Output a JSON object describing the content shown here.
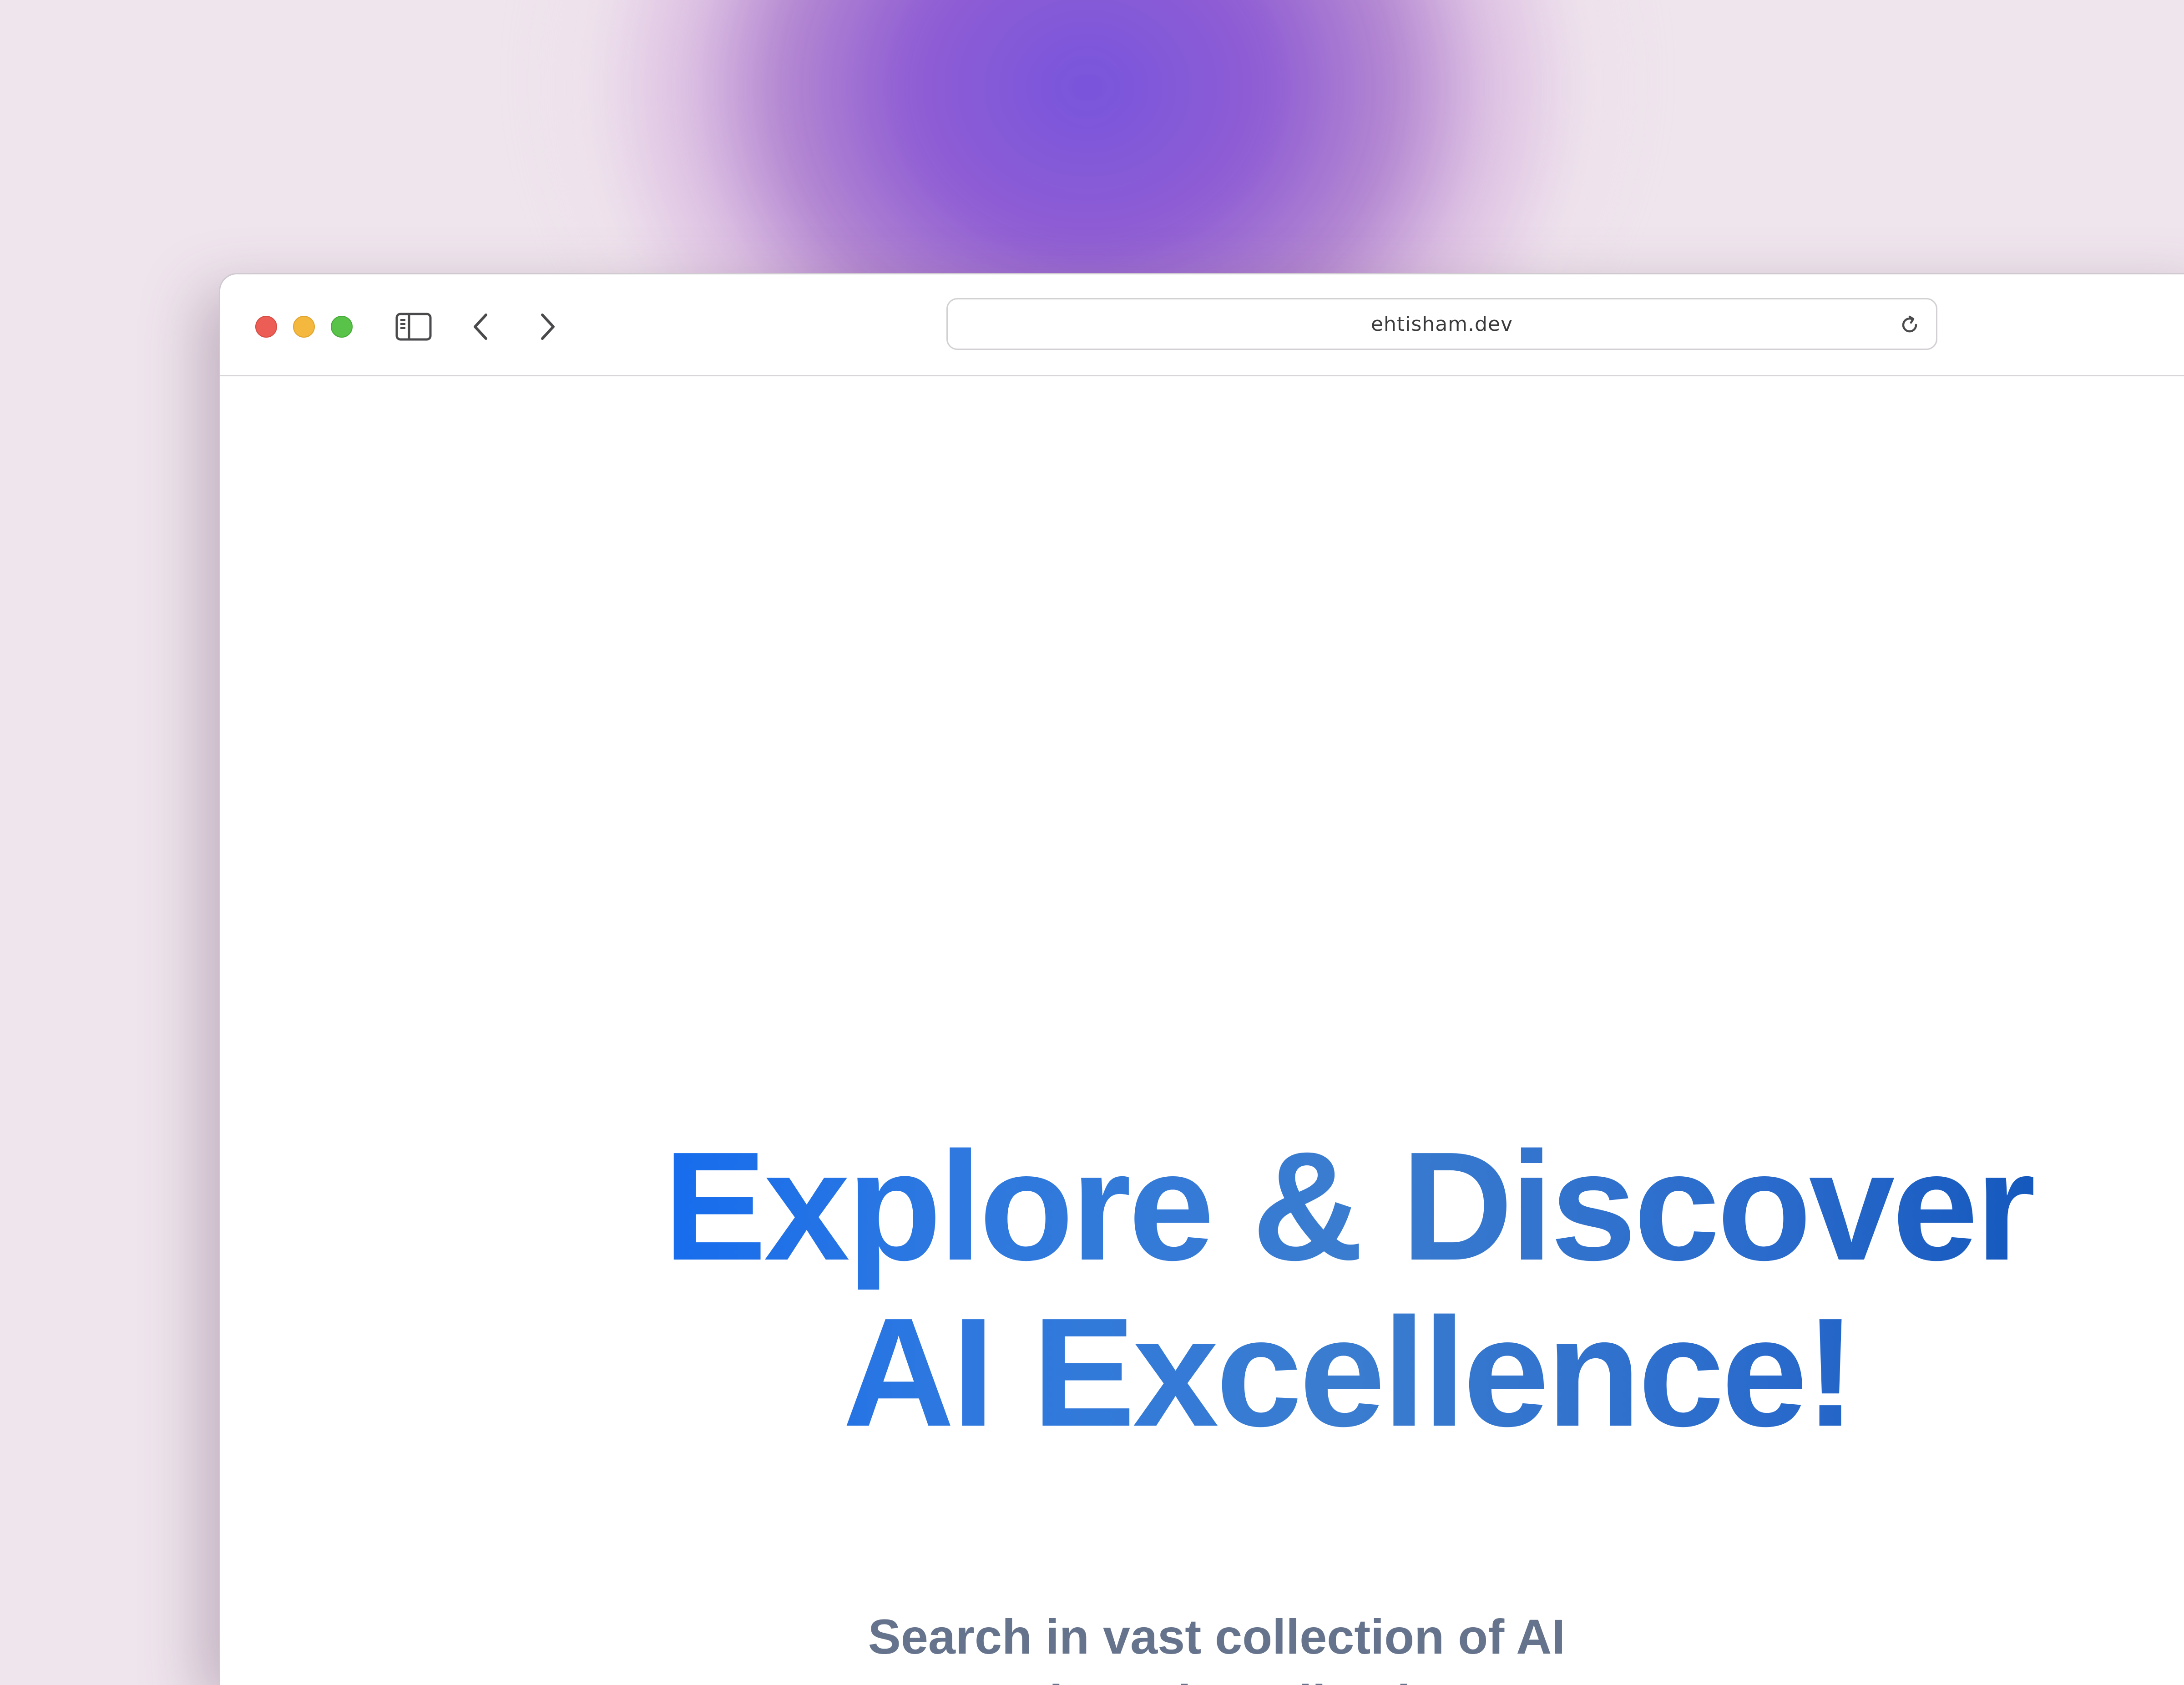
{
  "browser": {
    "url": "ehtisham.dev",
    "icons": {
      "sidebar": "sidebar-icon",
      "back": "chevron-left-icon",
      "forward": "chevron-right-icon",
      "reload": "reload-icon"
    },
    "traffic_colors": {
      "close": "#ec5e55",
      "minimize": "#f3b83d",
      "maximize": "#58c249"
    }
  },
  "hero": {
    "title_line1": "Explore & Discover",
    "title_line2": "AI Excellence!",
    "subtitle_line1": "Search in vast collection of AI",
    "subtitle_line2": "Tools and Application"
  },
  "colors": {
    "headline_gradient_start": "#0a66f5",
    "headline_gradient_end": "#0b4fb6",
    "subtitle": "#66738c",
    "background": "#efe5ed",
    "glow": "#7854dc"
  }
}
